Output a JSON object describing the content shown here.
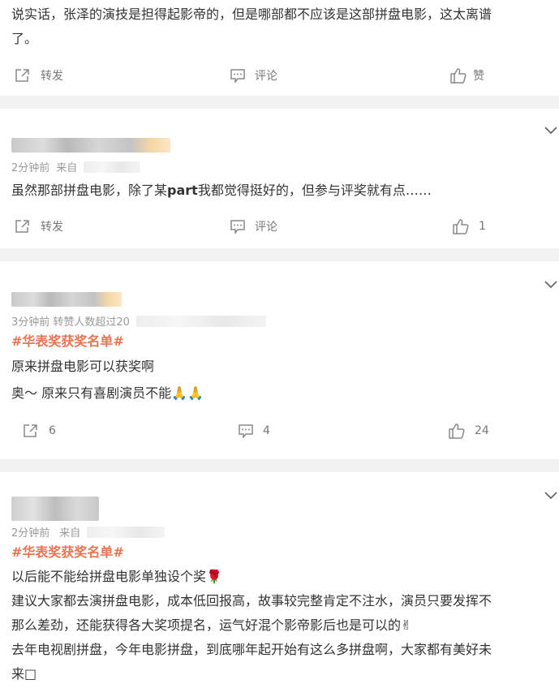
{
  "post1": {
    "line1": "说实话，张泽的演技是担得起影帝的，但是哪部都不应该是这部拼盘电影，这太离谱",
    "line2": "了。",
    "repost_label": "转发",
    "comment_label": "评论",
    "like_label": "赞"
  },
  "post2": {
    "time": "2分钟前",
    "source_prefix": "来自",
    "text_before": "虽然那部拼盘电影，除了某",
    "text_bold": "part",
    "text_after": "我都觉得挺好的，但参与评奖就有点……",
    "repost_label": "转发",
    "comment_label": "评论",
    "like_count": "1"
  },
  "post3": {
    "meta": "3分钟前  转赞人数超过20",
    "hashtag": "#华表奖获奖名单#",
    "line1": "原来拼盘电影可以获奖啊",
    "line2": "奥～ 原来只有喜剧演员不能🙏🙏",
    "repost_count": "6",
    "comment_count": "4",
    "like_count": "24"
  },
  "post4": {
    "time": "2分钟前",
    "source_prefix": "来自",
    "hashtag": "#华表奖获奖名单#",
    "line1": "以后能不能给拼盘电影单独设个奖🌹",
    "line2": "建议大家都去演拼盘电影，成本低回报高，故事较完整肯定不注水，演员只要发挥不",
    "line3": "那么差劲，还能获得各大奖项提名，运气好混个影帝影后也是可以的✌",
    "line4": "去年电视剧拼盘，今年电影拼盘，到底哪年起开始有这么多拼盘啊，大家都有美好未",
    "line5": "来□"
  },
  "colors": {
    "hashtag": "#eb7350",
    "divider": "#f2f2f2",
    "meta": "#999999"
  },
  "icons": [
    "repost-icon",
    "comment-icon",
    "like-icon",
    "chevron-down-icon"
  ]
}
